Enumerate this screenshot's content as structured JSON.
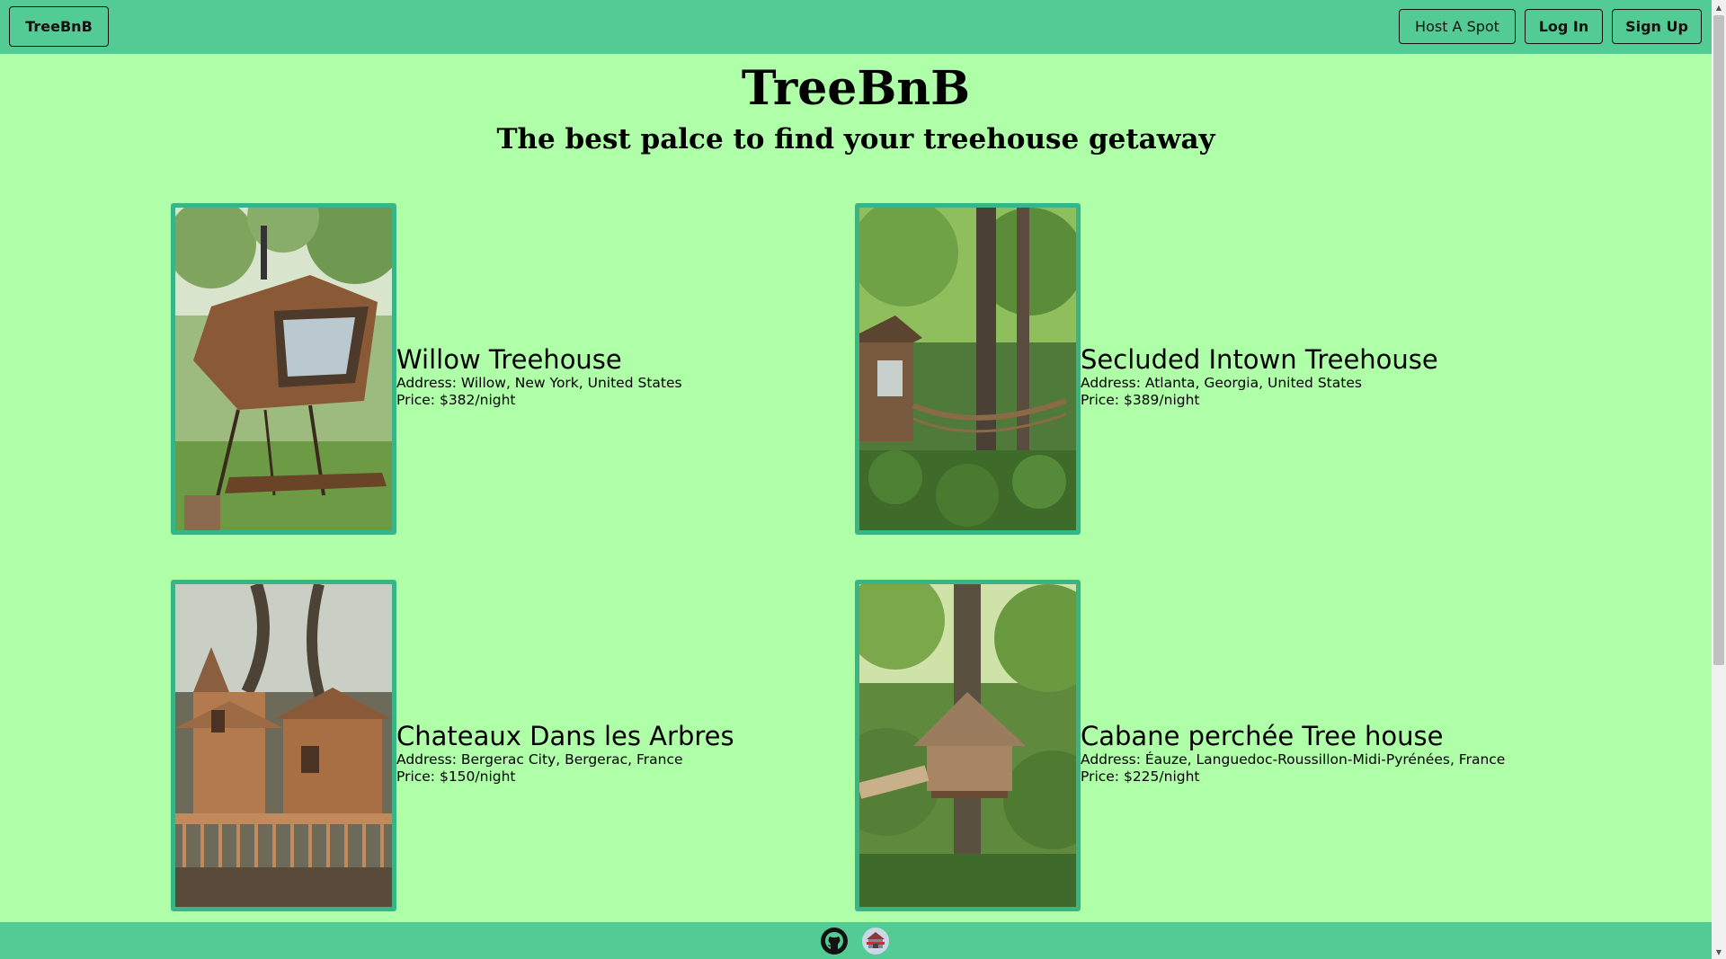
{
  "nav": {
    "brand": "TreeBnB",
    "host_label": "Host A Spot",
    "login_label": "Log In",
    "signup_label": "Sign Up"
  },
  "header": {
    "title": "TreeBnB",
    "subtitle": "The best palce to find your treehouse getaway"
  },
  "listings": [
    {
      "name": "Willow Treehouse",
      "address": "Address: Willow, New York, United States",
      "price": "Price: $382/night"
    },
    {
      "name": "Secluded Intown Treehouse",
      "address": "Address: Atlanta, Georgia, United States",
      "price": "Price: $389/night"
    },
    {
      "name": "Chateaux Dans les Arbres",
      "address": "Address: Bergerac City, Bergerac, France",
      "price": "Price: $150/night"
    },
    {
      "name": "Cabane perchée Tree house",
      "address": "Address: Éauze, Languedoc-Roussillon-Midi-Pyrénées, France",
      "price": "Price: $225/night"
    }
  ],
  "footer": {
    "icons": [
      "github-icon",
      "portfolio-icon"
    ]
  },
  "colors": {
    "page_background": "#aeffa8",
    "nav_background": "#52cc94",
    "card_border": "#37b586"
  }
}
